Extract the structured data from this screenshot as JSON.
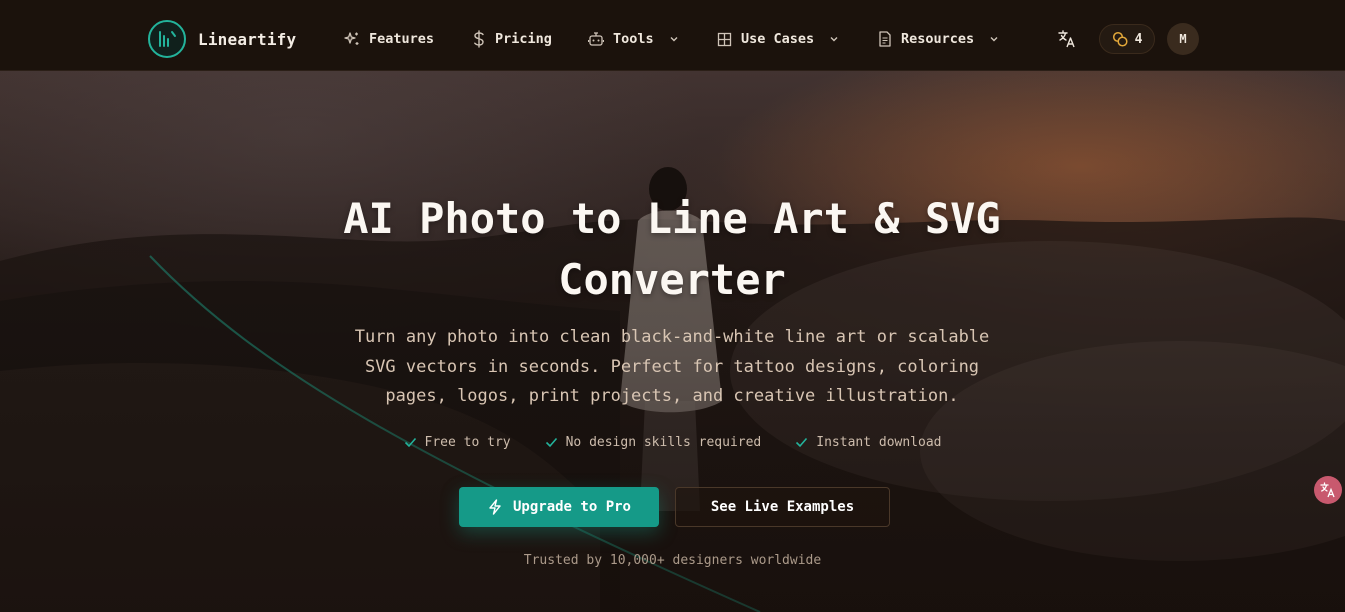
{
  "brand": {
    "name": "Lineartify",
    "logo_icon": "chart-bars-icon",
    "accent": "#23b39b"
  },
  "nav": {
    "items": [
      {
        "label": "Features",
        "icon": "sparkles-icon",
        "has_dropdown": false
      },
      {
        "label": "Pricing",
        "icon": "dollar-icon",
        "has_dropdown": false
      },
      {
        "label": "Tools",
        "icon": "robot-icon",
        "has_dropdown": true
      },
      {
        "label": "Use Cases",
        "icon": "grid-icon",
        "has_dropdown": true
      },
      {
        "label": "Resources",
        "icon": "document-icon",
        "has_dropdown": true
      }
    ],
    "language_icon": "translate-icon",
    "credits": {
      "icon": "coins-icon",
      "count": "4"
    },
    "avatar_initial": "M"
  },
  "hero": {
    "title_line1": "AI Photo to Line Art & SVG",
    "title_line2": "Converter",
    "subtitle_line1": "Turn any photo into clean black-and-white line art or scalable",
    "subtitle_line2": "SVG vectors in seconds. Perfect for tattoo designs, coloring",
    "subtitle_line3": "pages, logos, print projects, and creative illustration.",
    "features": [
      "Free to try",
      "No design skills required",
      "Instant download"
    ],
    "primary_button": "Upgrade to Pro",
    "secondary_button": "See Live Examples",
    "trusted_text": "Trusted by 10,000+ designers worldwide"
  },
  "colors": {
    "primary_button": "#159a88",
    "check": "#23b39b",
    "floating_button": "#c8596e"
  }
}
